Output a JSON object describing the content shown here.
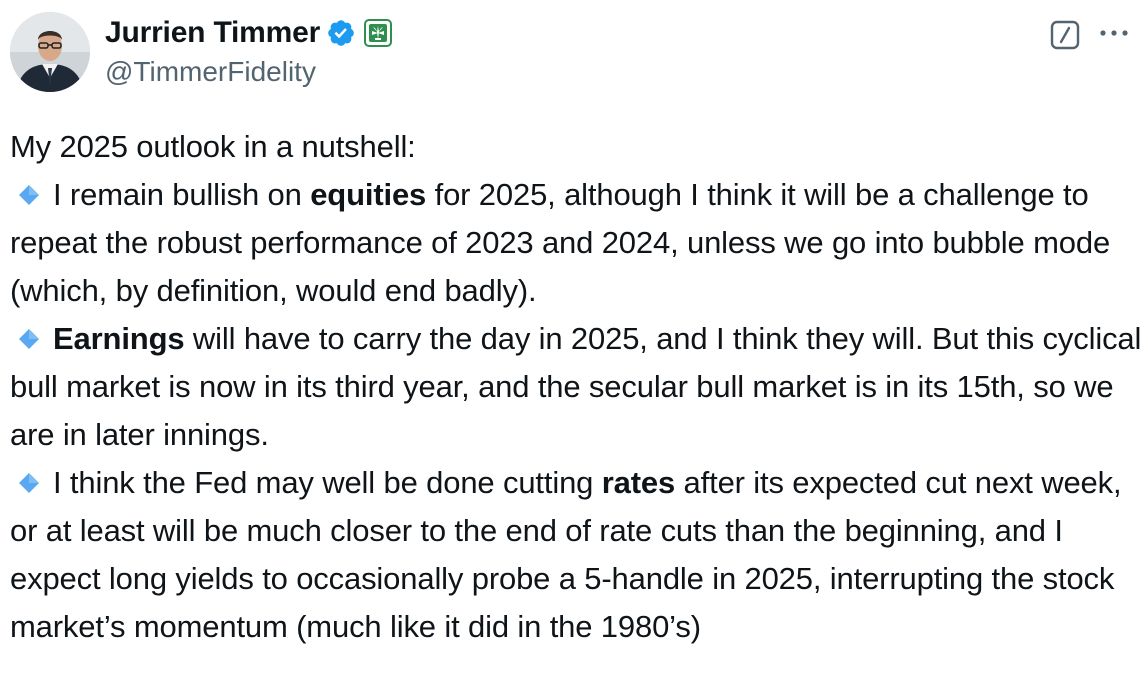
{
  "author": {
    "display_name": "Jurrien Timmer",
    "handle": "@TimmerFidelity",
    "verified_badge_icon": "verified-badge-icon",
    "affiliate_badge_icon": "fidelity-affiliate-icon",
    "accent_color": "#1d9bf0",
    "affiliate_color": "#2f8f4e"
  },
  "actions": {
    "grok_icon": "grok-icon",
    "more_icon": "more-options-icon"
  },
  "tweet": {
    "intro": "My 2025 outlook in a nutshell:",
    "bullet_icon": "small-blue-diamond-icon",
    "bullets": [
      {
        "before": "I remain bullish on ",
        "bold": "equities",
        "after": " for 2025, although I think it will be a challenge to repeat the robust performance of 2023 and 2024, unless we go into bubble mode (which, by definition, would end badly)."
      },
      {
        "before": "",
        "bold": "Earnings",
        "after": " will have to carry the day in 2025, and I think they will.  But this cyclical bull market is now in its third year, and the secular bull market is in its 15th, so we are in later innings."
      },
      {
        "before": "I think the Fed may well be done cutting ",
        "bold": "rates",
        "after": " after its expected cut next week, or at least will be much closer to the end of rate cuts than the beginning, and I expect long yields to occasionally probe a 5-handle in 2025, interrupting the stock market’s momentum (much like it did in the 1980’s)"
      }
    ]
  }
}
